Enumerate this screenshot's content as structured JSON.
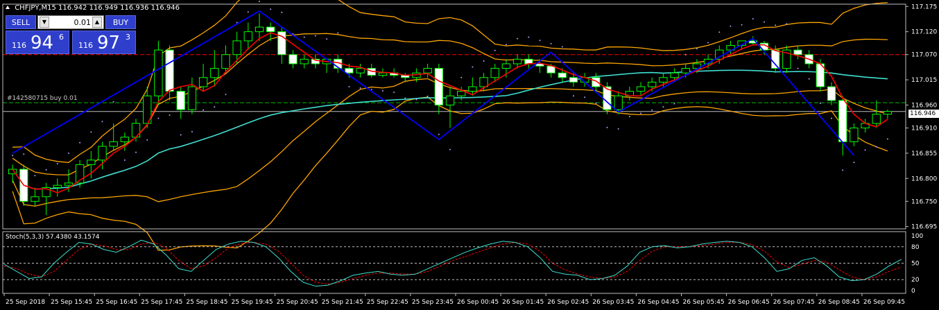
{
  "header": {
    "symbol_tf": "CHFJPY,M15",
    "ohlc": "116.942 116.949 116.936 116.946"
  },
  "trade_panel": {
    "sell_label": "SELL",
    "buy_label": "BUY",
    "lot_value": "0.01",
    "sell_prefix": "116",
    "sell_big": "94",
    "sell_sup": "6",
    "buy_prefix": "116",
    "buy_big": "97",
    "buy_sup": "3"
  },
  "order_line_label": "#142580715 buy 0.01",
  "current_price": "116.946",
  "stoch_label": "Stoch(5,3,3) 57.4380 43.1574",
  "colors": {
    "bg": "#000000",
    "grid": "#c0c0c0",
    "bull": "#00ff00",
    "bear_fill": "#ffffff",
    "zigzag": "#0000ff",
    "ma_fast": "#ff0000",
    "bands": "#ffa500",
    "ma_slow": "#40e0d0",
    "sar": "#b0a0ff",
    "stoch_main": "#40e0d0",
    "stoch_signal": "#ff0000"
  },
  "chart_data": [
    {
      "type": "candlestick",
      "title": "CHFJPY,M15",
      "y_ticks": [
        "117.175",
        "117.120",
        "117.070",
        "117.015",
        "116.960",
        "116.910",
        "116.855",
        "116.800",
        "116.750",
        "116.695"
      ],
      "ylim": [
        116.69,
        117.18
      ],
      "x_ticks": [
        "25 Sep 2018",
        "25 Sep 15:45",
        "25 Sep 16:45",
        "25 Sep 17:45",
        "25 Sep 18:45",
        "25 Sep 19:45",
        "25 Sep 20:45",
        "25 Sep 21:45",
        "25 Sep 22:45",
        "25 Sep 23:45",
        "26 Sep 00:45",
        "26 Sep 01:45",
        "26 Sep 02:45",
        "26 Sep 03:45",
        "26 Sep 04:45",
        "26 Sep 05:45",
        "26 Sep 06:45",
        "26 Sep 07:45",
        "26 Sep 08:45",
        "26 Sep 09:45"
      ],
      "grid": false,
      "order_level": 116.965,
      "red_level": 117.07,
      "current": 116.946,
      "candles": [
        [
          116.81,
          116.83,
          116.79,
          116.82
        ],
        [
          116.82,
          116.83,
          116.74,
          116.75
        ],
        [
          116.75,
          116.78,
          116.74,
          116.76
        ],
        [
          116.76,
          116.79,
          116.72,
          116.78
        ],
        [
          116.78,
          116.8,
          116.76,
          116.785
        ],
        [
          116.785,
          116.82,
          116.77,
          116.79
        ],
        [
          116.79,
          116.84,
          116.78,
          116.83
        ],
        [
          116.83,
          116.86,
          116.8,
          116.84
        ],
        [
          116.84,
          116.88,
          116.82,
          116.87
        ],
        [
          116.87,
          116.92,
          116.86,
          116.88
        ],
        [
          116.88,
          116.9,
          116.86,
          116.89
        ],
        [
          116.89,
          116.93,
          116.88,
          116.92
        ],
        [
          116.92,
          117.0,
          116.91,
          116.98
        ],
        [
          116.98,
          117.1,
          116.96,
          117.08
        ],
        [
          117.08,
          117.09,
          116.97,
          116.99
        ],
        [
          116.99,
          117.0,
          116.93,
          116.95
        ],
        [
          116.95,
          117.02,
          116.94,
          117.0
        ],
        [
          117.0,
          117.05,
          116.99,
          117.02
        ],
        [
          117.02,
          117.08,
          117.0,
          117.04
        ],
        [
          117.04,
          117.09,
          117.03,
          117.07
        ],
        [
          117.07,
          117.12,
          117.05,
          117.1
        ],
        [
          117.1,
          117.14,
          117.08,
          117.12
        ],
        [
          117.12,
          117.16,
          117.1,
          117.13
        ],
        [
          117.13,
          117.14,
          117.1,
          117.12
        ],
        [
          117.12,
          117.13,
          117.05,
          117.07
        ],
        [
          117.07,
          117.08,
          117.04,
          117.05
        ],
        [
          117.05,
          117.07,
          117.04,
          117.06
        ],
        [
          117.06,
          117.07,
          117.04,
          117.05
        ],
        [
          117.05,
          117.06,
          117.03,
          117.06
        ],
        [
          117.06,
          117.07,
          117.03,
          117.04
        ],
        [
          117.04,
          117.05,
          117.02,
          117.03
        ],
        [
          117.03,
          117.05,
          117.02,
          117.04
        ],
        [
          117.04,
          117.05,
          117.02,
          117.025
        ],
        [
          117.025,
          117.04,
          117.02,
          117.03
        ],
        [
          117.03,
          117.04,
          117.02,
          117.025
        ],
        [
          117.025,
          117.03,
          117.01,
          117.02
        ],
        [
          117.02,
          117.04,
          117.01,
          117.03
        ],
        [
          117.03,
          117.05,
          117.02,
          117.04
        ],
        [
          117.04,
          117.05,
          116.94,
          116.96
        ],
        [
          116.96,
          117.0,
          116.91,
          116.98
        ],
        [
          116.98,
          117.0,
          116.97,
          116.99
        ],
        [
          116.99,
          117.02,
          116.98,
          117.0
        ],
        [
          117.0,
          117.03,
          116.99,
          117.02
        ],
        [
          117.02,
          117.05,
          117.01,
          117.04
        ],
        [
          117.04,
          117.06,
          117.02,
          117.05
        ],
        [
          117.05,
          117.07,
          117.04,
          117.06
        ],
        [
          117.06,
          117.07,
          117.04,
          117.05
        ],
        [
          117.05,
          117.06,
          117.03,
          117.045
        ],
        [
          117.045,
          117.05,
          117.02,
          117.03
        ],
        [
          117.03,
          117.04,
          117.01,
          117.02
        ],
        [
          117.02,
          117.03,
          117.0,
          117.01
        ],
        [
          117.01,
          117.03,
          117.0,
          117.02
        ],
        [
          117.02,
          117.03,
          116.99,
          117.0
        ],
        [
          117.0,
          117.01,
          116.94,
          116.95
        ],
        [
          116.95,
          116.99,
          116.94,
          116.98
        ],
        [
          116.98,
          117.0,
          116.97,
          116.99
        ],
        [
          116.99,
          117.01,
          116.98,
          117.0
        ],
        [
          117.0,
          117.02,
          116.99,
          117.01
        ],
        [
          117.01,
          117.03,
          117.0,
          117.02
        ],
        [
          117.02,
          117.04,
          117.01,
          117.03
        ],
        [
          117.03,
          117.05,
          117.02,
          117.04
        ],
        [
          117.04,
          117.06,
          117.03,
          117.05
        ],
        [
          117.05,
          117.07,
          117.04,
          117.06
        ],
        [
          117.06,
          117.09,
          117.05,
          117.08
        ],
        [
          117.08,
          117.1,
          117.07,
          117.09
        ],
        [
          117.09,
          117.1,
          117.08,
          117.1
        ],
        [
          117.1,
          117.11,
          117.09,
          117.095
        ],
        [
          117.095,
          117.1,
          117.07,
          117.08
        ],
        [
          117.08,
          117.09,
          117.03,
          117.04
        ],
        [
          117.04,
          117.09,
          117.03,
          117.08
        ],
        [
          117.08,
          117.09,
          117.06,
          117.07
        ],
        [
          117.07,
          117.08,
          117.04,
          117.05
        ],
        [
          117.05,
          117.06,
          116.99,
          117.0
        ],
        [
          117.0,
          117.01,
          116.96,
          116.97
        ],
        [
          116.97,
          116.98,
          116.85,
          116.88
        ],
        [
          116.88,
          116.92,
          116.87,
          116.91
        ],
        [
          116.91,
          116.93,
          116.9,
          116.92
        ],
        [
          116.92,
          116.97,
          116.91,
          116.94
        ],
        [
          116.94,
          116.95,
          116.93,
          116.946
        ]
      ]
    },
    {
      "type": "line",
      "title": "Stoch(5,3,3) 57.4380 43.1574",
      "y_ticks": [
        "100",
        "80",
        "50",
        "20",
        "0"
      ],
      "ylim": [
        0,
        100
      ],
      "levels": [
        80,
        50,
        20
      ],
      "series": [
        {
          "name": "Stoch main",
          "values": [
            48,
            35,
            22,
            25,
            50,
            70,
            88,
            85,
            75,
            70,
            80,
            92,
            85,
            65,
            40,
            35,
            55,
            75,
            85,
            90,
            88,
            80,
            60,
            35,
            15,
            8,
            10,
            18,
            28,
            32,
            35,
            30,
            28,
            30,
            40,
            50,
            60,
            70,
            78,
            85,
            90,
            88,
            80,
            60,
            35,
            30,
            28,
            20,
            22,
            28,
            45,
            70,
            80,
            82,
            78,
            80,
            85,
            88,
            90,
            88,
            80,
            60,
            35,
            40,
            55,
            60,
            45,
            25,
            18,
            20,
            30,
            45,
            57
          ]
        },
        {
          "name": "Stoch signal",
          "values": [
            45,
            40,
            30,
            25,
            35,
            55,
            75,
            85,
            82,
            75,
            75,
            85,
            88,
            78,
            55,
            40,
            45,
            60,
            78,
            86,
            88,
            85,
            72,
            50,
            28,
            15,
            12,
            15,
            22,
            28,
            32,
            32,
            30,
            30,
            35,
            45,
            55,
            62,
            70,
            78,
            85,
            88,
            85,
            72,
            50,
            38,
            30,
            25,
            22,
            25,
            35,
            55,
            72,
            80,
            80,
            80,
            82,
            85,
            88,
            88,
            84,
            72,
            52,
            42,
            48,
            55,
            52,
            38,
            25,
            20,
            25,
            35,
            43
          ]
        }
      ]
    }
  ]
}
